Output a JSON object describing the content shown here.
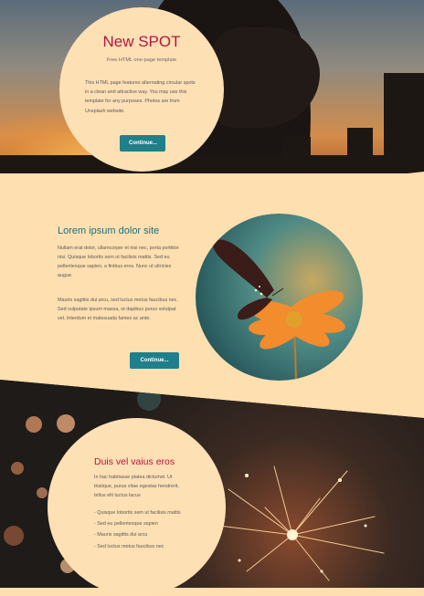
{
  "hero": {
    "title": "New SPOT",
    "subtitle": "Free HTML one-page template",
    "description": "This HTML page features alternating circular spots in a clean and attractive way. You may use this template for any purposes. Photos are from Unsplash website.",
    "button_label": "Continue..."
  },
  "section2": {
    "title": "Lorem ipsum dolor site",
    "paragraph1": "Nullam erat dolor, ullamcorper et nisi nec, porta porttitor nisi. Quisque lobortis sem ut facilisis mattis. Sed eu pellentesque sapien, a finibus eros. Nunc ut ultricies augue.",
    "paragraph2": "Mauris sagittis dui arcu, sed luctus metus faucibus nec. Sed vulputate ipsum massa, ut dapibus purus volutpat vel. Interdum et malesuada fames ac ante.",
    "button_label": "Continue..."
  },
  "section3": {
    "title": "Duis vel vaius eros",
    "paragraph": "In hac habitasse platea dictumst. Ut tristique, purus vitae egestas hendrerit, tellus elit luctus lacus",
    "items": [
      "- Quisque lobortis sem ut facilisis mattis",
      "- Sed eu pellentesque sapien",
      "- Mauris sagittis dui arcu",
      "- Sed luctus metus faucibus nec"
    ]
  },
  "colors": {
    "accent_red": "#b5163b",
    "accent_teal": "#1f7f8a",
    "cream": "#fee0b5"
  }
}
